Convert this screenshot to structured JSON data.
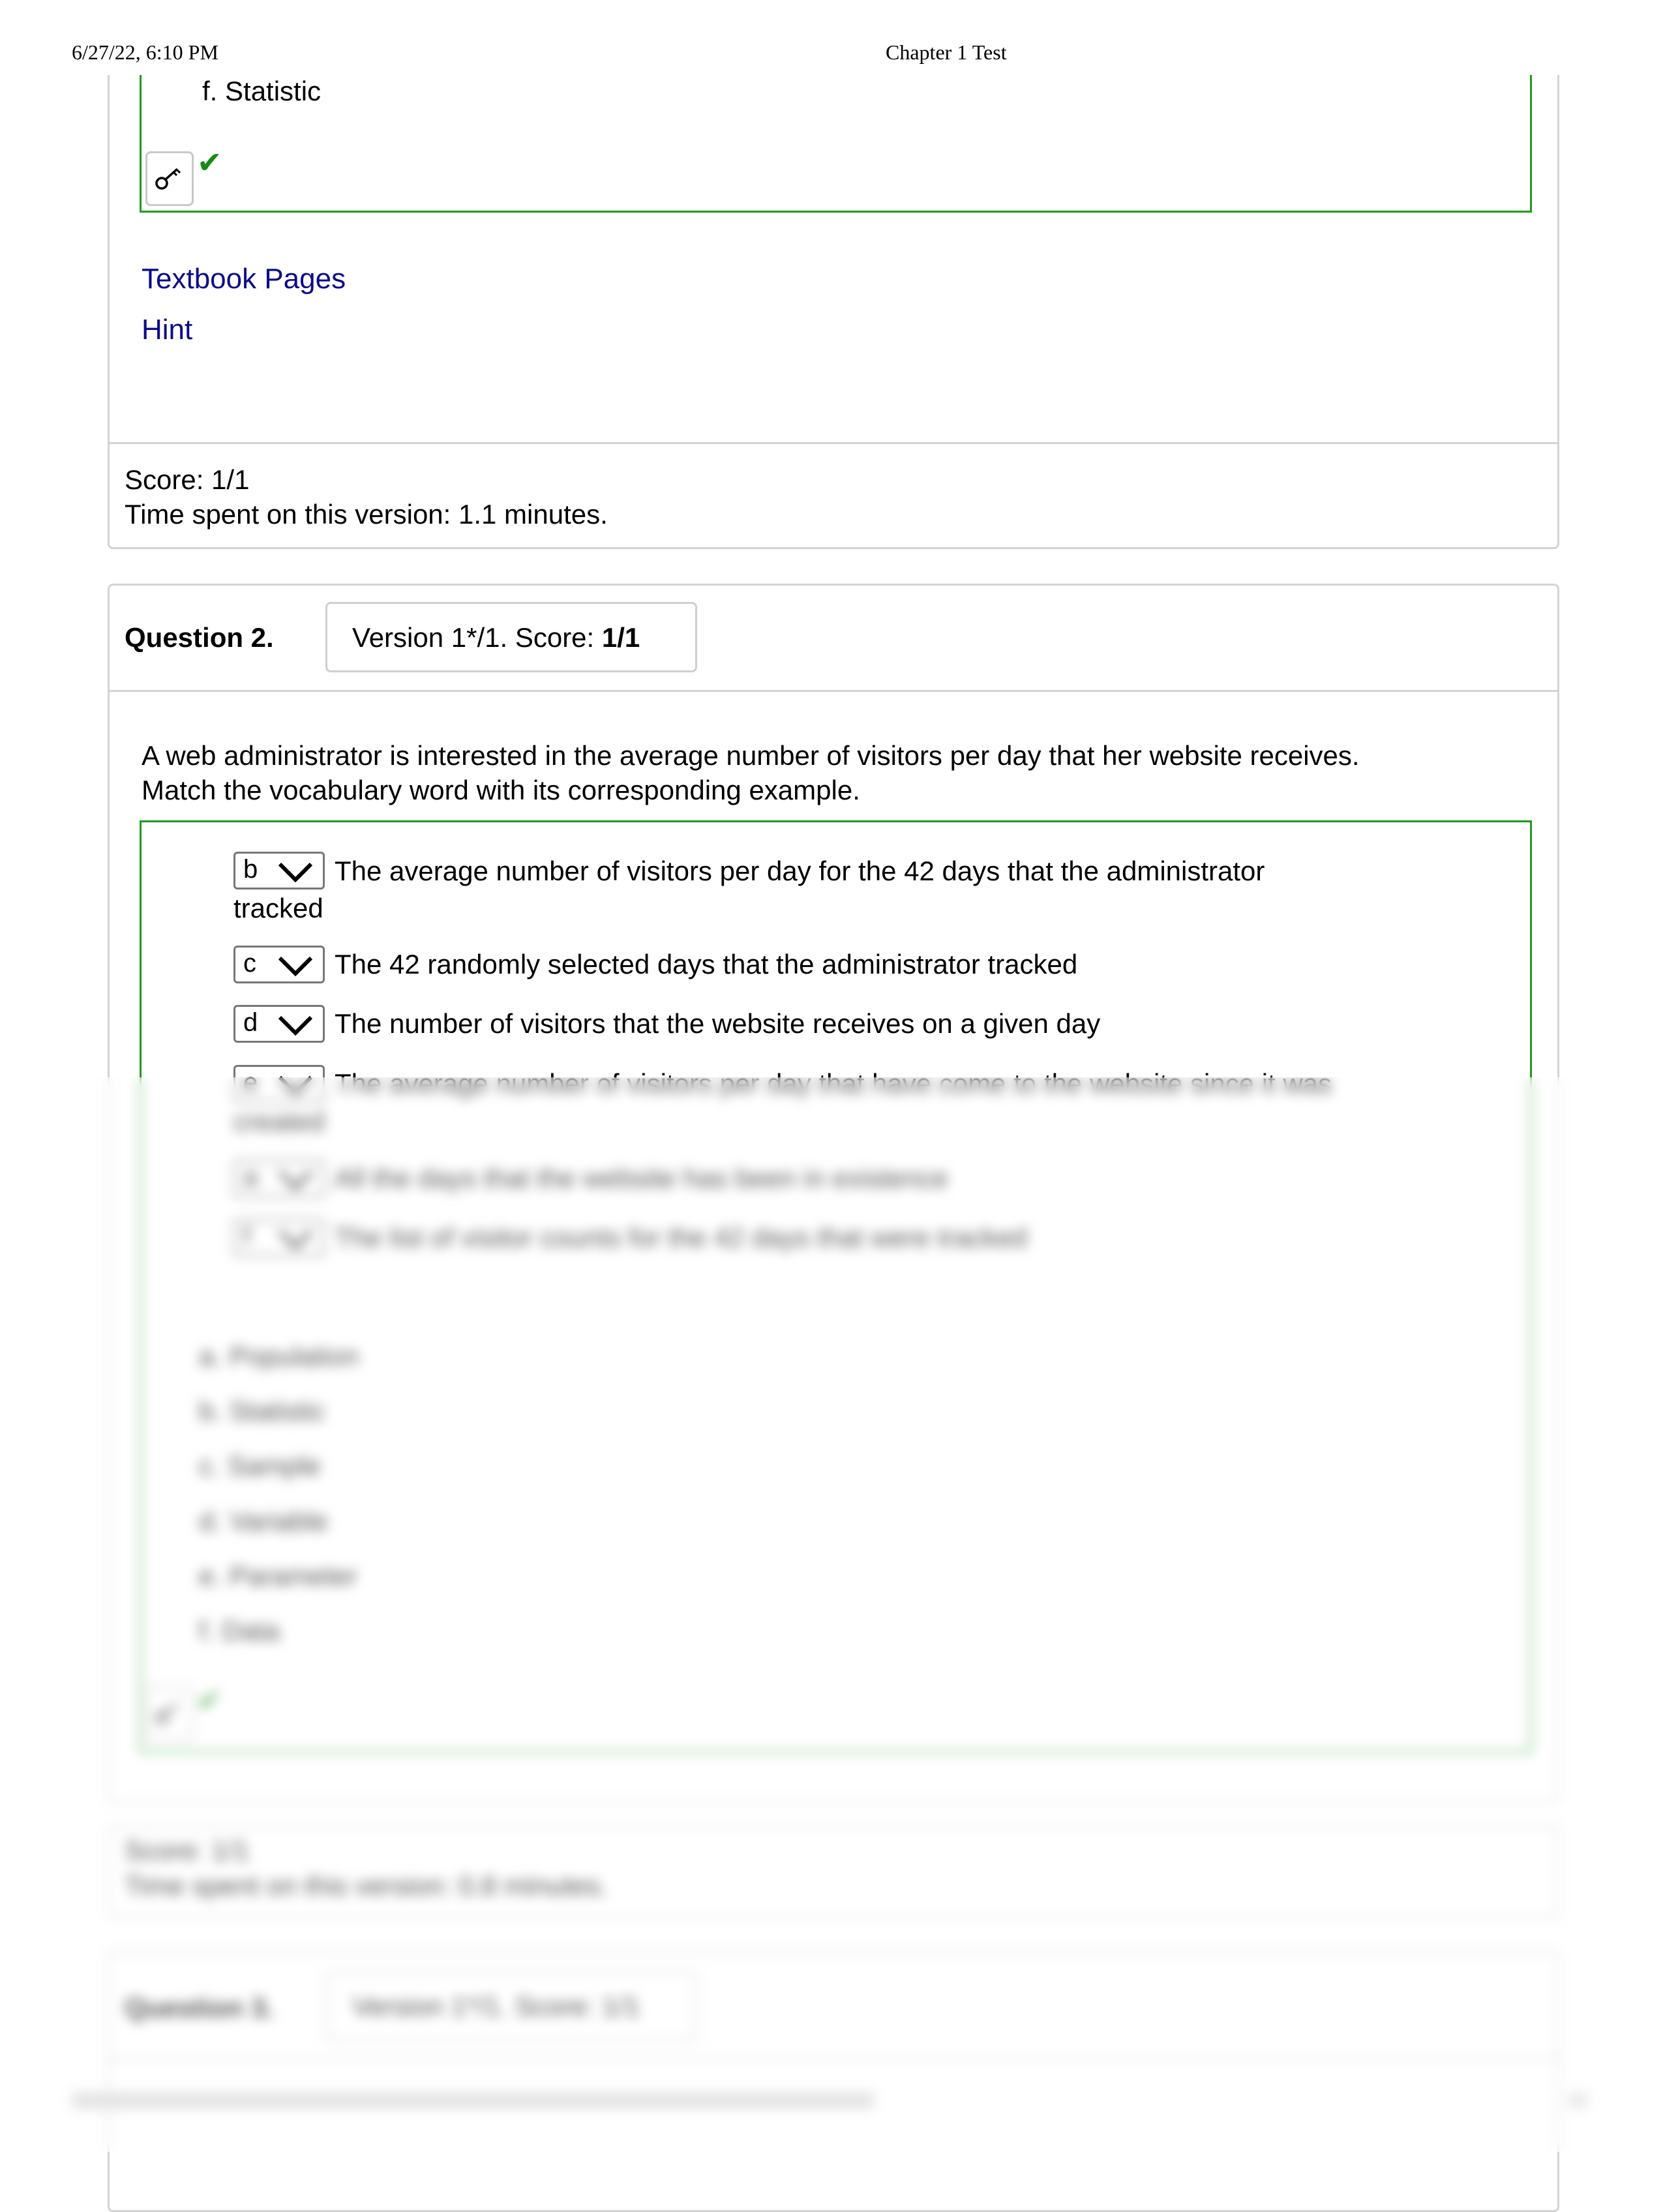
{
  "print_header": {
    "datetime": "6/27/22, 6:10 PM",
    "title": "Chapter 1 Test"
  },
  "question1": {
    "last_option": "f. Statistic",
    "links": {
      "textbook": "Textbook Pages",
      "hint": "Hint"
    },
    "score": "Score: 1/1",
    "time_spent": "Time spent on this version: 1.1 minutes."
  },
  "question2": {
    "label": "Question 2.",
    "version_prefix": "Version 1*/1. Score: ",
    "version_score": "1/1",
    "prompt_line1": "A web administrator is interested in the average number of visitors per day that her website receives.",
    "prompt_line2": "Match the vocabulary word with its corresponding example.",
    "rows": [
      {
        "selected": "b",
        "line1": "The average number of visitors per day for the 42 days that the administrator",
        "line2": "tracked"
      },
      {
        "selected": "c",
        "line1": "The 42 randomly selected days that the administrator tracked"
      },
      {
        "selected": "d",
        "line1": "The number of visitors that the website receives on a given day"
      },
      {
        "selected": "e",
        "line1": "The average number of visitors per day that have come to the website since it was",
        "line2": "created"
      },
      {
        "selected": "a",
        "line1": "All the days that the website has been in existence"
      },
      {
        "selected": "f",
        "line1": "The list of visitor counts for the 42 days that were tracked"
      }
    ],
    "options": [
      "a. Population",
      "b. Statistic",
      "c. Sample",
      "d. Variable",
      "e. Parameter",
      "f. Data"
    ],
    "score": "Score: 1/1",
    "time_spent": "Time spent on this version: 0.8 minutes."
  },
  "question3": {
    "label": "Question 3.",
    "version": "Version 1*/1. Score: 1/1"
  },
  "colors": {
    "correct_green": "#1e9a1e",
    "link_blue": "#0c0c8a",
    "border_gray": "#d4d4d4"
  },
  "icons": [
    "key-icon",
    "checkmark-icon",
    "chevron-down-icon"
  ]
}
